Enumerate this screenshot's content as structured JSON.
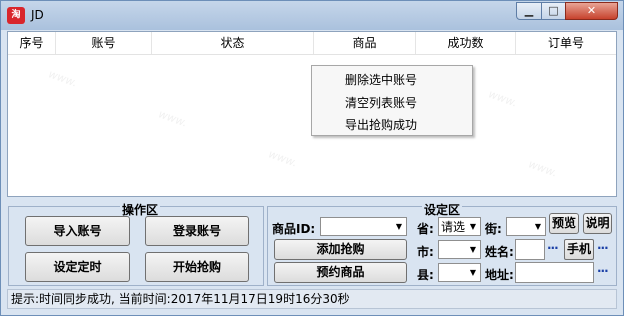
{
  "window": {
    "title": "JD",
    "app_icon": "jd-app-icon",
    "min_glyph": "▁",
    "max_glyph": "□",
    "close_glyph": "✕"
  },
  "table": {
    "columns": [
      "序号",
      "账号",
      "状态",
      "商品",
      "成功数",
      "订单号"
    ],
    "rows": []
  },
  "context_menu": {
    "items": [
      "删除选中账号",
      "清空列表账号",
      "导出抢购成功"
    ]
  },
  "operations": {
    "title": "操作区",
    "import_label": "导入账号",
    "login_label": "登录账号",
    "timer_label": "设定定时",
    "start_label": "开始抢购"
  },
  "settings": {
    "title": "设定区",
    "product_id_label": "商品ID:",
    "product_id_value": "",
    "add_label": "添加抢购",
    "reserve_label": "预约商品",
    "province_label": "省:",
    "province_value": "请选",
    "street_label": "街:",
    "street_value": "",
    "city_label": "市:",
    "city_value": "",
    "county_label": "县:",
    "county_value": "",
    "name_label": "姓名:",
    "name_value": "",
    "phone_label": "手机",
    "address_label": "地址:",
    "address_value": "",
    "preview_label": "预览",
    "help_label": "说明",
    "dots": "···"
  },
  "status": {
    "text": "提示:时间同步成功, 当前时间:2017年11月17日19时16分30秒"
  }
}
